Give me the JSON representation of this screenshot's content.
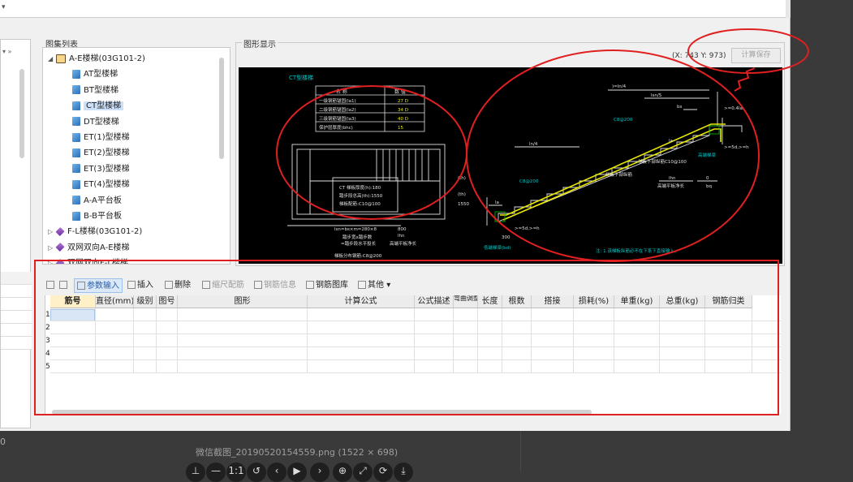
{
  "window": {
    "dropdown_glyph": "▾"
  },
  "left_strip": {
    "arrows": "▾ »",
    "bottom_number": "0"
  },
  "atlas_panel": {
    "label": "图集列表",
    "items": [
      {
        "label": "A-E楼梯(03G101-2)",
        "icon": "book-icon",
        "expander": "◢",
        "level": 0
      },
      {
        "label": "AT型楼梯",
        "icon": "page-icon",
        "level": 1
      },
      {
        "label": "BT型楼梯",
        "icon": "page-icon",
        "level": 1
      },
      {
        "label": "CT型楼梯",
        "icon": "page-icon",
        "level": 1,
        "selected": true
      },
      {
        "label": "DT型楼梯",
        "icon": "page-icon",
        "level": 1
      },
      {
        "label": "ET(1)型楼梯",
        "icon": "page-icon",
        "level": 1
      },
      {
        "label": "ET(2)型楼梯",
        "icon": "page-icon",
        "level": 1
      },
      {
        "label": "ET(3)型楼梯",
        "icon": "page-icon",
        "level": 1
      },
      {
        "label": "ET(4)型楼梯",
        "icon": "page-icon",
        "level": 1
      },
      {
        "label": "A-A平台板",
        "icon": "page-icon",
        "level": 1
      },
      {
        "label": "B-B平台板",
        "icon": "page-icon",
        "level": 1
      },
      {
        "label": "F-L楼梯(03G101-2)",
        "icon": "stack-icon",
        "expander": "▷",
        "level": 0
      },
      {
        "label": "双网双向A-E楼梯",
        "icon": "stack-icon",
        "expander": "▷",
        "level": 0
      },
      {
        "label": "双网双向F-L楼梯",
        "icon": "stack-icon",
        "expander": "▷",
        "level": 0
      }
    ]
  },
  "graphics_panel": {
    "label": "图形显示",
    "coords": "(X: 743 Y: 973)",
    "calc_save_label": "计算保存",
    "drawing": {
      "title": "CT型楼梯",
      "table_headers": [
        "名 称",
        "数 值"
      ],
      "table_rows": [
        [
          "一级钢筋锚固(la1)",
          "27 D"
        ],
        [
          "二级钢筋锚固(la2)",
          "34 D"
        ],
        [
          "三级钢筋锚固(la3)",
          "40 D"
        ],
        [
          "保护层厚度(bhc)",
          "15"
        ]
      ],
      "plan_notes": [
        "CT 梯板厚度(h):180",
        "踏步段总高(th):1550",
        "梯板配筋:C10@100"
      ],
      "plan_bottom_label": "lsn=bs×m=280×8",
      "plan_side_values": [
        "800",
        "lhn"
      ],
      "plan_step_notes": [
        "踏步宽x踏步数",
        "=踏步段水平投长",
        "高端平板净长"
      ],
      "plan_dist_label": "梯板分布钢筋:C8@200",
      "side_labels": [
        "(th)",
        "1550",
        "(th)",
        "lhn"
      ],
      "elev_labels": {
        "top_dim1": ")=ln/4",
        "top_dim2": "lsn/5",
        "top_bs": "bs",
        "top_right": ">=0.4la",
        "rebar_top": "C8@200",
        "mid_dim": "ln/4",
        "la_mark": "la",
        "right_5d": ">=5d,>=h",
        "high_beam": "高端梯梁",
        "lower_rebar": "梯板下部纵筋C10@100",
        "lower_rebar2": "梯板下部纵筋",
        "lhn_label": "lhn",
        "lhn_note": "高端平板净长",
        "bq_label": "bq",
        "zero": "0",
        "left_rebar": "C8@200",
        "left_la": "la",
        "bottom_5d": ">=5d,>=h",
        "bottom_300": "300",
        "low_beam": "低端梯梁(bd)",
        "note": "注: 1.该梯板纵筋必不在下系下直接输入。"
      }
    }
  },
  "toolbar": {
    "items": [
      {
        "label": "",
        "icon": "move-up-icon",
        "state": "normal"
      },
      {
        "label": "",
        "icon": "move-down-icon",
        "state": "normal"
      },
      {
        "label": "参数输入",
        "icon": "param-icon",
        "state": "active"
      },
      {
        "label": "插入",
        "icon": "insert-icon",
        "state": "normal"
      },
      {
        "label": "删除",
        "icon": "delete-icon",
        "state": "normal"
      },
      {
        "label": "缩尺配筋",
        "icon": "scale-icon",
        "state": "disabled"
      },
      {
        "label": "钢筋信息",
        "icon": "info-icon",
        "state": "disabled"
      },
      {
        "label": "钢筋图库",
        "icon": "library-icon",
        "state": "normal"
      },
      {
        "label": "其他",
        "icon": "other-icon",
        "state": "normal",
        "dropdown": "▾"
      }
    ]
  },
  "grid": {
    "columns": [
      "筋号",
      "直径(mm)",
      "级别",
      "图号",
      "图形",
      "计算公式",
      "公式描述",
      "弯曲调整",
      "长度",
      "根数",
      "搭接",
      "损耗(%)",
      "单重(kg)",
      "总重(kg)",
      "钢筋归类"
    ],
    "row_numbers": [
      "1",
      "2",
      "3",
      "4",
      "5"
    ]
  },
  "viewer": {
    "caption": "微信截图_20190520154559.png (1522 × 698)",
    "controls": [
      "⊥",
      "—",
      "1:1",
      "↺",
      "‹",
      "▶",
      "›",
      "⊕",
      "⤢",
      "⟳",
      "⤓"
    ]
  },
  "colors": {
    "annotation_red": "#e02020",
    "cad_cyan": "#00c8c8",
    "cad_yellow": "#e8e800",
    "cad_green": "#00c800"
  }
}
